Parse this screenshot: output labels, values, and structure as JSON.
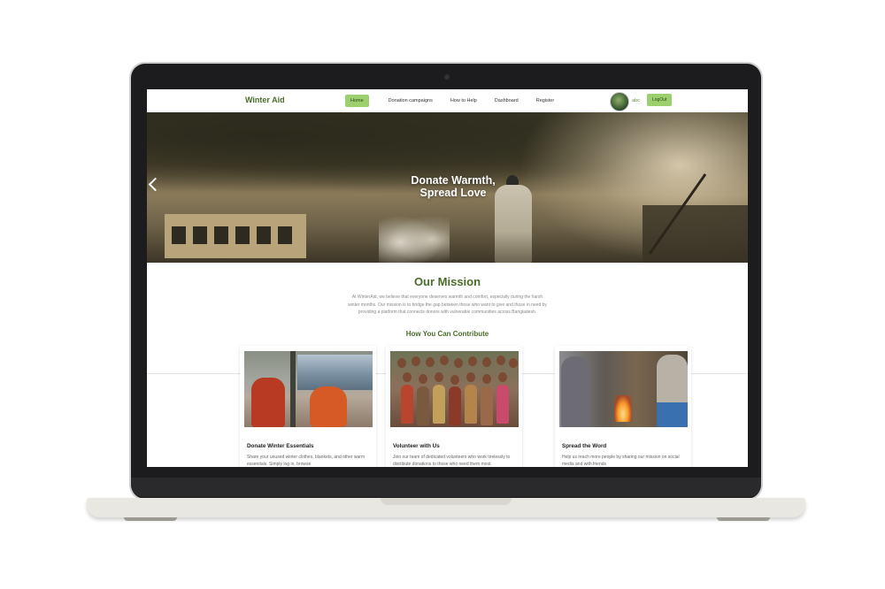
{
  "nav": {
    "brand": "Winter Aid",
    "links": [
      "Home",
      "Donation campaigns",
      "How to Help",
      "Dashboard",
      "Register"
    ],
    "user_name": "abc",
    "logout_label": "LogOut"
  },
  "hero": {
    "title_line1": "Donate Warmth,",
    "title_line2": "Spread Love"
  },
  "mission": {
    "title": "Our Mission",
    "text": "At WinterAid, we believe that everyone deserves warmth and comfort, especially during the harsh winter months. Our mission is to bridge the gap between those who want to give and those in need by providing a platform that connects donors with vulnerable communities across Bangladesh."
  },
  "contribute": {
    "title": "How You Can Contribute",
    "cards": [
      {
        "title": "Donate Winter Essentials",
        "text": "Share your unused winter clothes, blankets, and other warm essentials. Simply log in, browse"
      },
      {
        "title": "Volunteer with Us",
        "text": "Join our team of dedicated volunteers who work tirelessly to distribute donations to those who need them most."
      },
      {
        "title": "Spread the Word",
        "text": "Help us reach more people by sharing our mission on social media and with friends"
      }
    ]
  },
  "colors": {
    "brand_green": "#4a6b2a",
    "accent_green": "#9ccf6e"
  }
}
